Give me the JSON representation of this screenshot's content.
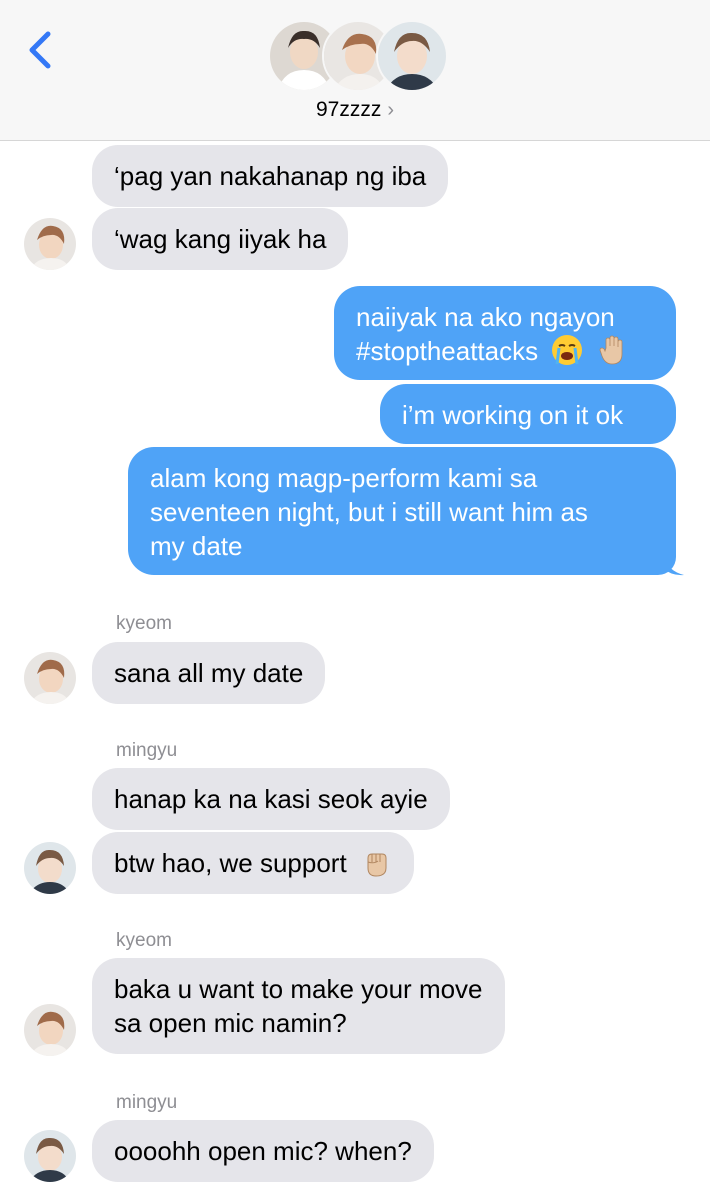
{
  "header": {
    "group_name": "97zzzz",
    "chevron": "›",
    "back_icon": "chevron-left-icon"
  },
  "colors": {
    "incoming_bubble": "#e5e5ea",
    "outgoing_bubble": "#4fa3f7",
    "accent": "#3478f6",
    "sender_label": "#8e8e93"
  },
  "messages": {
    "m1": "‘pag yan nakahanap ng iba",
    "m2": "‘wag kang iiyak ha",
    "m3_line1": "naiiyak na ako ngayon",
    "m3_line2": "#stoptheattacks",
    "m4": "i’m working on it ok",
    "m5_line1": "alam kong magp-perform kami sa",
    "m5_line2": "seventeen night, but i still want him as",
    "m5_line3": "my date",
    "sender1": "kyeom",
    "m6": "sana all my date",
    "sender2": "mingyu",
    "m7": "hanap ka na kasi seok ayie",
    "m8": "btw hao, we support",
    "sender3": "kyeom",
    "m9_line1": "baka u want to make your move",
    "m9_line2": "sa open mic namin?",
    "sender4": "mingyu",
    "m10": "oooohh open mic? when?"
  },
  "emojis": {
    "m3": [
      "loudly-crying-face-icon",
      "raised-hand-icon"
    ],
    "m8": [
      "raised-fist-icon"
    ]
  }
}
